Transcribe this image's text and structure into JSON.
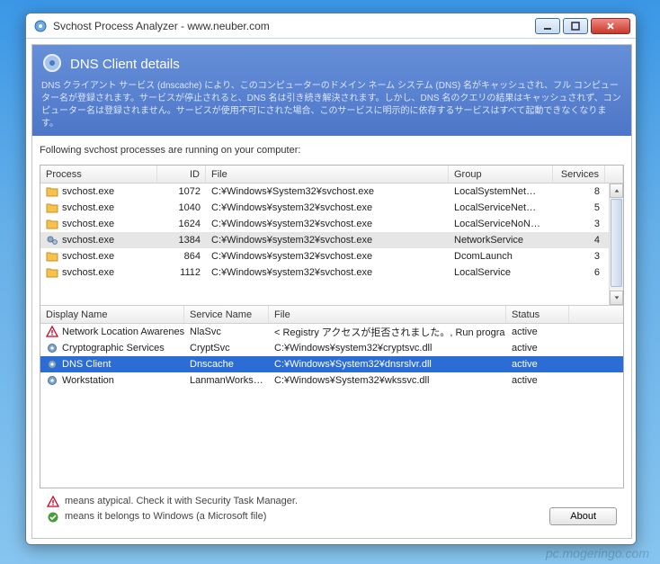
{
  "window": {
    "title": "Svchost Process Analyzer - www.neuber.com"
  },
  "header": {
    "title": "DNS Client details",
    "description": "DNS クライアント サービス (dnscache) により、このコンピューターのドメイン ネーム システム (DNS) 名がキャッシュされ、フル コンピューター名が登録されます。サービスが停止されると、DNS 名は引き続き解決されます。しかし、DNS 名のクエリの結果はキャッシュされず、コンピューター名は登録されません。サービスが使用不可にされた場合、このサービスに明示的に依存するサービスはすべて起動できなくなります。"
  },
  "message": "Following svchost processes are running on your computer:",
  "upper": {
    "columns": [
      "Process",
      "ID",
      "File",
      "Group",
      "Services"
    ],
    "rows": [
      {
        "icon": "folder",
        "process": "svchost.exe",
        "id": "1072",
        "file": "C:¥Windows¥System32¥svchost.exe",
        "group": "LocalSystemNet…",
        "services": "8"
      },
      {
        "icon": "folder",
        "process": "svchost.exe",
        "id": "1040",
        "file": "C:¥Windows¥system32¥svchost.exe",
        "group": "LocalServiceNet…",
        "services": "5"
      },
      {
        "icon": "folder",
        "process": "svchost.exe",
        "id": "1624",
        "file": "C:¥Windows¥system32¥svchost.exe",
        "group": "LocalServiceNoN…",
        "services": "3"
      },
      {
        "icon": "gears",
        "process": "svchost.exe",
        "id": "1384",
        "file": "C:¥Windows¥system32¥svchost.exe",
        "group": "NetworkService",
        "services": "4",
        "selected": true
      },
      {
        "icon": "folder",
        "process": "svchost.exe",
        "id": "864",
        "file": "C:¥Windows¥system32¥svchost.exe",
        "group": "DcomLaunch",
        "services": "3"
      },
      {
        "icon": "folder",
        "process": "svchost.exe",
        "id": "1112",
        "file": "C:¥Windows¥system32¥svchost.exe",
        "group": "LocalService",
        "services": "6"
      }
    ]
  },
  "lower": {
    "columns": [
      "Display Name",
      "Service Name",
      "File",
      "Status"
    ],
    "rows": [
      {
        "icon": "warn",
        "displayName": "Network Location Awareness",
        "serviceName": "NlaSvc",
        "file": "< Registry アクセスが拒否されました。, Run progra…",
        "status": "active"
      },
      {
        "icon": "gear",
        "displayName": "Cryptographic Services",
        "serviceName": "CryptSvc",
        "file": "C:¥Windows¥system32¥cryptsvc.dll",
        "status": "active"
      },
      {
        "icon": "gear",
        "displayName": "DNS Client",
        "serviceName": "Dnscache",
        "file": "C:¥Windows¥System32¥dnsrslvr.dll",
        "status": "active",
        "selected": true
      },
      {
        "icon": "gear",
        "displayName": "Workstation",
        "serviceName": "LanmanWorks…",
        "file": "C:¥Windows¥System32¥wkssvc.dll",
        "status": "active"
      }
    ]
  },
  "footer": {
    "legend1": "means atypical. Check it with Security Task Manager.",
    "legend2": "means it belongs to Windows (a Microsoft file)",
    "about": "About"
  },
  "watermark": "pc.mogeringo.com"
}
